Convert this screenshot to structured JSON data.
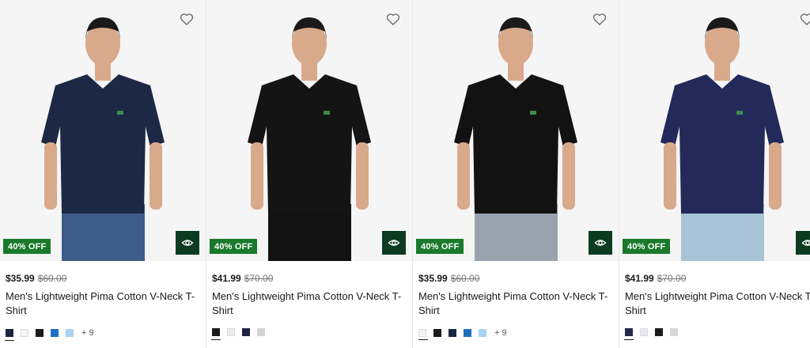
{
  "badge_text": "40% OFF",
  "products": [
    {
      "price": "$35.99",
      "original_price": "$60.00",
      "name": "Men's Lightweight Pima Cotton V-Neck T-Shirt",
      "swatch_colors": [
        "#1c2540",
        "#f4f4f4",
        "#1a1a1a",
        "#1f6fc0",
        "#a9d3f2"
      ],
      "more_colors": "+ 9",
      "shirt_color": "#1d2944"
    },
    {
      "price": "$41.99",
      "original_price": "$70.00",
      "name": "Men's Lightweight Pima Cotton V-Neck T-Shirt",
      "swatch_colors": [
        "#1a1a1a",
        "#e9e9ee",
        "#1f2340",
        "#d4d4d8"
      ],
      "more_colors": "",
      "shirt_color": "#141414"
    },
    {
      "price": "$35.99",
      "original_price": "$60.00",
      "name": "Men's Lightweight Pima Cotton V-Neck T-Shirt",
      "swatch_colors": [
        "#f4f4f4",
        "#1a1a1a",
        "#1c2540",
        "#1f6fc0",
        "#a9d3f2"
      ],
      "more_colors": "+ 9",
      "shirt_color": "#121212"
    },
    {
      "price": "$41.99",
      "original_price": "$70.00",
      "name": "Men's Lightweight Pima Cotton V-Neck T-Shirt",
      "swatch_colors": [
        "#242748",
        "#e8e8f0",
        "#1a1a1a",
        "#d6d6da"
      ],
      "more_colors": "",
      "shirt_color": "#232a5a"
    }
  ],
  "colors": {
    "badge_green": "#1a7a2b",
    "quickview_green": "#0d3b22",
    "top_accent": "#e0533a"
  },
  "icons": {
    "wishlist": "heart-outline-icon",
    "quickview": "eye-icon"
  }
}
